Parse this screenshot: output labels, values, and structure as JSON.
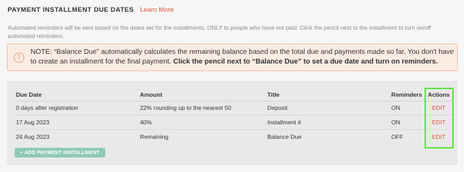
{
  "header": {
    "title": "PAYMENT INSTALLMENT DUE DATES",
    "learn_more": "Learn More"
  },
  "description": "Automated reminders will be sent based on the dates set for the installments, ONLY to people who have not paid. Click the pencil next to the installment to turn on/off automated reminders.",
  "note": {
    "icon": "exclamation-circle-icon",
    "glyph": "!",
    "text_plain": "NOTE: “Balance Due” automatically calculates the remaining balance based on the total due and payments made so far. You don't have to create an installment for the final payment. ",
    "text_bold": "Click the pencil next to “Balance Due” to set a due date and turn on reminders."
  },
  "table": {
    "headers": {
      "due_date": "Due Date",
      "amount": "Amount",
      "title": "Title",
      "reminders": "Reminders",
      "actions": "Actions"
    },
    "rows": [
      {
        "due_date": "0 days after registration",
        "amount": "22% rounding up to the nearest 50",
        "title": "Deposit",
        "reminders": "ON",
        "action": "EDIT"
      },
      {
        "due_date": "17 Aug 2023",
        "amount": "40%",
        "title": "Installment #",
        "reminders": "ON",
        "action": "EDIT"
      },
      {
        "due_date": "24 Aug 2023",
        "amount": "Remaining",
        "title": "Balance Due",
        "reminders": "OFF",
        "action": "EDIT"
      }
    ]
  },
  "add_button": "+ ADD PAYMENT INSTALLMENT",
  "colors": {
    "accent": "#e0533c",
    "note_bg": "#fbece2",
    "note_border": "#f2bd9e",
    "button_bg": "#8ecab2",
    "highlight": "#58e33b"
  }
}
